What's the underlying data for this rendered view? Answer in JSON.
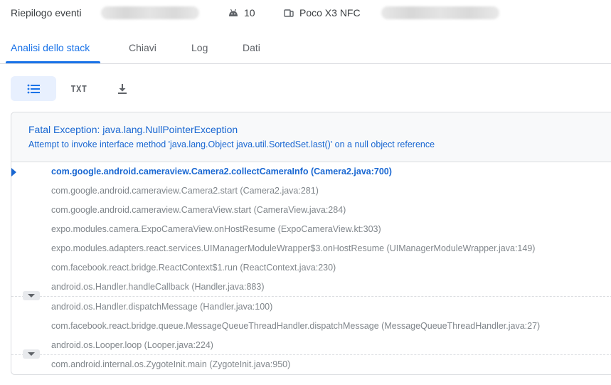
{
  "header": {
    "title": "Riepilogo eventi",
    "android_version": "10",
    "device": "Poco X3 NFC"
  },
  "tabs": [
    {
      "label": "Analisi dello stack",
      "active": true
    },
    {
      "label": "Chiavi",
      "active": false
    },
    {
      "label": "Log",
      "active": false
    },
    {
      "label": "Dati",
      "active": false
    }
  ],
  "toolbar": {
    "txt_label": "TXT"
  },
  "exception": {
    "title": "Fatal Exception: java.lang.NullPointerException",
    "message": "Attempt to invoke interface method 'java.lang.Object java.util.SortedSet.last()' on a null object reference"
  },
  "frames": [
    "com.google.android.cameraview.Camera2.collectCameraInfo (Camera2.java:700)",
    "com.google.android.cameraview.Camera2.start (Camera2.java:281)",
    "com.google.android.cameraview.CameraView.start (CameraView.java:284)",
    "expo.modules.camera.ExpoCameraView.onHostResume (ExpoCameraView.kt:303)",
    "expo.modules.adapters.react.services.UIManagerModuleWrapper$3.onHostResume (UIManagerModuleWrapper.java:149)",
    "com.facebook.react.bridge.ReactContext$1.run (ReactContext.java:230)",
    "android.os.Handler.handleCallback (Handler.java:883)",
    "android.os.Handler.dispatchMessage (Handler.java:100)",
    "com.facebook.react.bridge.queue.MessageQueueThreadHandler.dispatchMessage (MessageQueueThreadHandler.java:27)",
    "android.os.Looper.loop (Looper.java:224)",
    "com.android.internal.os.ZygoteInit.main (ZygoteInit.java:950)"
  ],
  "icons": {
    "android": "android-icon",
    "device": "phone-icon",
    "list": "list-icon",
    "download": "download-icon",
    "expand": "chevron-down-icon"
  },
  "colors": {
    "accent": "#1a73e8",
    "active_frame": "#1967d2"
  }
}
